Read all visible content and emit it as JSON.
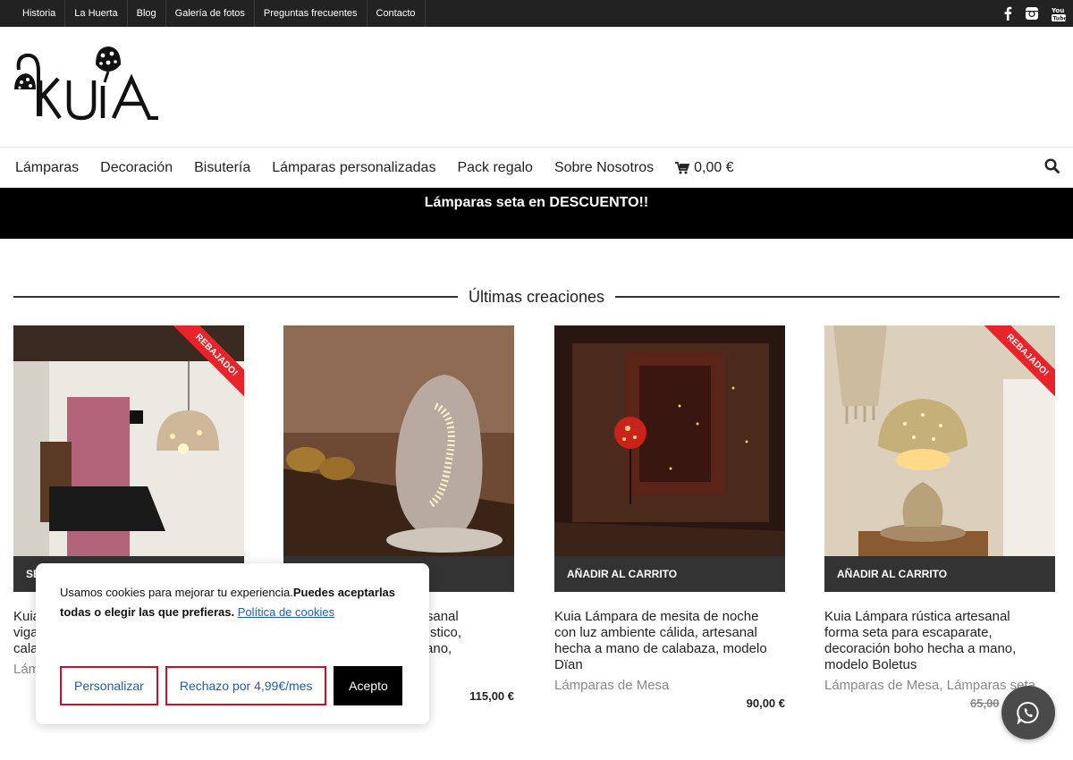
{
  "topbar": {
    "links": [
      "Historia",
      "La Huerta",
      "Blog",
      "Galería de fotos",
      "Preguntas frecuentes",
      "Contacto"
    ],
    "social": [
      "facebook-icon",
      "instagram-icon",
      "youtube-icon"
    ]
  },
  "logo": {
    "text": "KUIA"
  },
  "nav": {
    "items": [
      "Lámparas",
      "Decoración",
      "Bisutería",
      "Lámparas personalizadas",
      "Pack regalo",
      "Sobre Nosotros"
    ],
    "cart_total": "0,00 €"
  },
  "banner": {
    "text": "Lámparas seta en DESCUENTO!!"
  },
  "section": {
    "title": "Últimas creaciones"
  },
  "products": [
    {
      "badge": "REBAJADO!",
      "cart_label": "SE",
      "title_lines": [
        "Kuia",
        "viga",
        "cala"
      ],
      "category": "Lám",
      "price": ""
    },
    {
      "badge": "",
      "cart_label": "",
      "title_lines": [
        "artesanal",
        "te rústico,",
        "a mano,"
      ],
      "category": "",
      "price": "115,00 €"
    },
    {
      "badge": "",
      "cart_label": "AÑADIR AL CARRITO",
      "title_lines": [
        "Kuia Lámpara de mesita de noche",
        "con luz ambiente cálida, artesanal",
        "hecha a mano de calabaza, modelo",
        "Dïan"
      ],
      "category": "Lámparas de Mesa",
      "price": "90,00 €"
    },
    {
      "badge": "REBAJADO!",
      "cart_label": "AÑADIR AL CARRITO",
      "title_lines": [
        "Kuia Lámpara rústica artesanal",
        "forma seta para escaparate,",
        "decoración boho hecha a mano,",
        "modelo Boletus"
      ],
      "category": "Lámparas de Mesa, Lámparas seta",
      "price": "65,00"
    }
  ],
  "cookie": {
    "text": "Usamos cookies para mejorar tu experiencia.",
    "bold": "Puedes aceptarlas todas o elegir las que prefieras.",
    "link": "Política de cookies",
    "buttons": {
      "customize": "Personalizar",
      "reject": "Rechazo por 4,99€/mes",
      "accept": "Acepto"
    }
  },
  "colors": {
    "accent": "#e8242a",
    "topbar": "#222222",
    "banner": "#000000"
  }
}
